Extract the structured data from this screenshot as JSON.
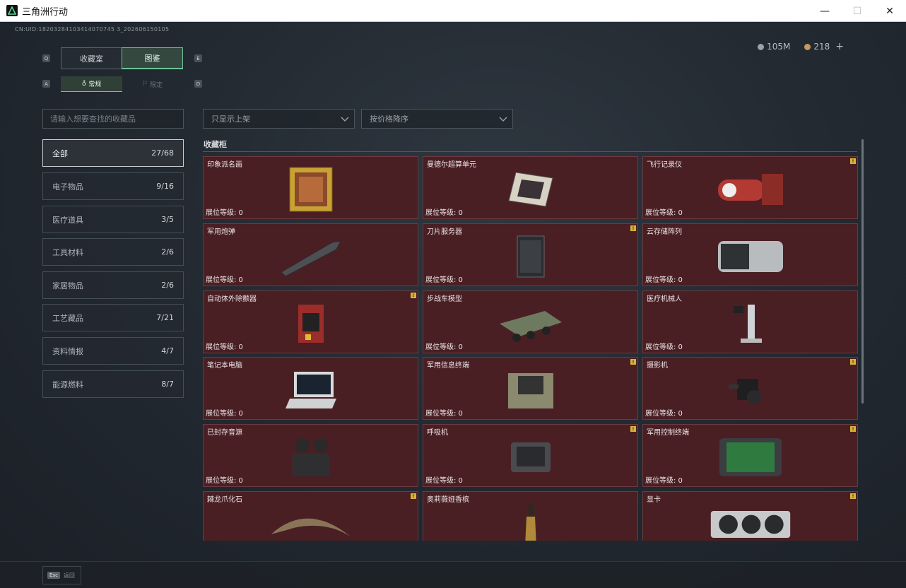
{
  "window": {
    "title": "三角洲行动",
    "minimize": "—",
    "maximize": "☐",
    "close": "✕"
  },
  "header": {
    "uid": "CN:UID:18203284103414070745 3_202606150105",
    "currency_silver": "105M",
    "currency_gold": "218",
    "add": "+"
  },
  "tabs": {
    "left_key": "Q",
    "right_key": "E",
    "items": [
      {
        "label": "收藏室"
      },
      {
        "label": "图鉴"
      }
    ],
    "sub_left_key": "A",
    "sub_right_key": "D",
    "sub_items": [
      {
        "label": "常规"
      },
      {
        "label": "限定"
      }
    ]
  },
  "search": {
    "placeholder": "请输入想要查找的收藏品"
  },
  "filters": {
    "show": "只显示上架",
    "sort": "按价格降序"
  },
  "categories": [
    {
      "label": "全部",
      "count": "27/68",
      "active": true
    },
    {
      "label": "电子物品",
      "count": "9/16"
    },
    {
      "label": "医疗道具",
      "count": "3/5"
    },
    {
      "label": "工具材料",
      "count": "2/6"
    },
    {
      "label": "家居物品",
      "count": "2/6"
    },
    {
      "label": "工艺藏品",
      "count": "7/21"
    },
    {
      "label": "资料情报",
      "count": "4/7"
    },
    {
      "label": "能源燃料",
      "count": "8/7"
    }
  ],
  "section": {
    "title": "收藏柜"
  },
  "level_label": "展位等级: 0",
  "badge_text": "!",
  "items": [
    {
      "name": "印象派名画",
      "icon": "painting-icon",
      "badge": false
    },
    {
      "name": "曼德尔超算单元",
      "icon": "chip-icon",
      "badge": false
    },
    {
      "name": "飞行记录仪",
      "icon": "flight-recorder-icon",
      "badge": true
    },
    {
      "name": "军用炮弹",
      "icon": "shell-icon",
      "badge": false
    },
    {
      "name": "刀片服务器",
      "icon": "server-icon",
      "badge": true
    },
    {
      "name": "云存储阵列",
      "icon": "storage-array-icon",
      "badge": false
    },
    {
      "name": "自动体外除颤器",
      "icon": "defibrillator-icon",
      "badge": true
    },
    {
      "name": "步战车模型",
      "icon": "ifv-model-icon",
      "badge": false
    },
    {
      "name": "医疗机械人",
      "icon": "medical-robot-icon",
      "badge": false
    },
    {
      "name": "笔记本电脑",
      "icon": "laptop-icon",
      "badge": false
    },
    {
      "name": "军用信息终端",
      "icon": "terminal-icon",
      "badge": true
    },
    {
      "name": "摄影机",
      "icon": "camera-icon",
      "badge": true
    },
    {
      "name": "已封存音源",
      "icon": "reel-recorder-icon",
      "badge": false
    },
    {
      "name": "呼吸机",
      "icon": "ventilator-icon",
      "badge": true
    },
    {
      "name": "军用控制终端",
      "icon": "control-terminal-icon",
      "badge": true
    },
    {
      "name": "棘龙爪化石",
      "icon": "claw-fossil-icon",
      "badge": true
    },
    {
      "name": "奥莉薇娅香槟",
      "icon": "champagne-icon",
      "badge": false
    },
    {
      "name": "显卡",
      "icon": "gpu-icon",
      "badge": true
    }
  ],
  "footer": {
    "esc_key": "Esc",
    "esc_label": "返回"
  }
}
